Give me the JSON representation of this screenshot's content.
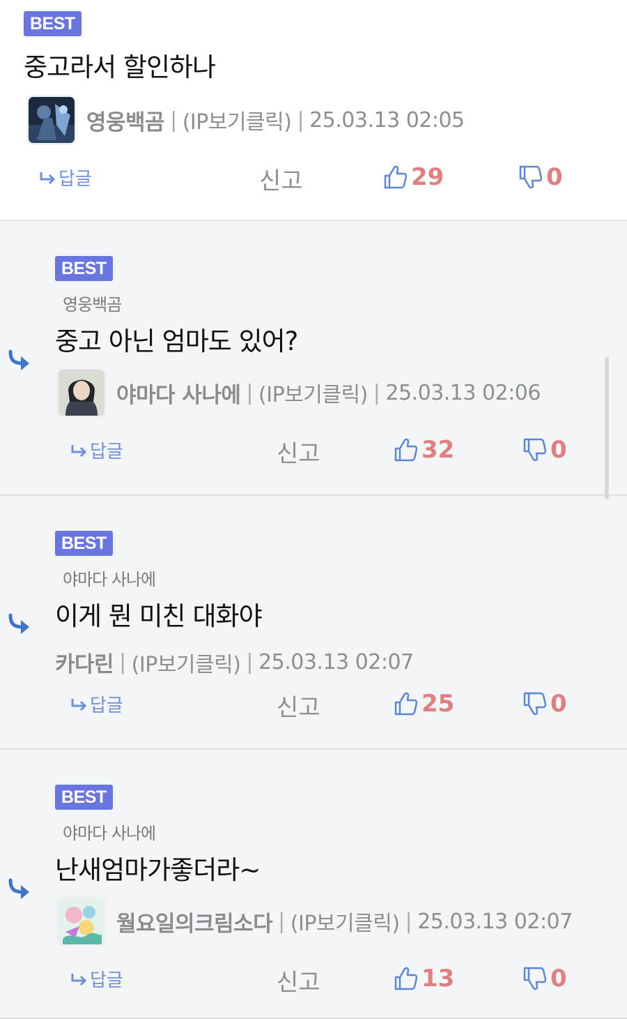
{
  "comments": [
    {
      "badge": "BEST",
      "mention": "",
      "text": "중고라서 할인하나",
      "author": "영웅백곰",
      "ip": "(IP보기클릭)",
      "timestamp": "25.03.13 02:05",
      "reply_label": "답글",
      "report_label": "신고",
      "likes": "29",
      "dislikes": "0"
    },
    {
      "badge": "BEST",
      "mention": "영웅백곰",
      "text": "중고 아닌 엄마도 있어?",
      "author": "야마다 사나에",
      "ip": "(IP보기클릭)",
      "timestamp": "25.03.13 02:06",
      "reply_label": "답글",
      "report_label": "신고",
      "likes": "32",
      "dislikes": "0"
    },
    {
      "badge": "BEST",
      "mention": "야마다 사나에",
      "text": "이게 뭔 미친 대화야",
      "author": "카다린",
      "ip": "(IP보기클릭)",
      "timestamp": "25.03.13 02:07",
      "reply_label": "답글",
      "report_label": "신고",
      "likes": "25",
      "dislikes": "0"
    },
    {
      "badge": "BEST",
      "mention": "야마다 사나에",
      "text": "난새엄마가좋더라~",
      "author": "월요일의크림소다",
      "ip": "(IP보기클릭)",
      "timestamp": "25.03.13 02:07",
      "reply_label": "답글",
      "report_label": "신고",
      "likes": "13",
      "dislikes": "0"
    }
  ],
  "icons": {
    "reply": "reply-arrow-icon",
    "thumbs_up": "thumbs-up-icon",
    "thumbs_down": "thumbs-down-icon",
    "nested_reply": "nested-reply-arrow-icon"
  },
  "colors": {
    "best_badge": "#6a76e0",
    "vote_count": "#e07f7f",
    "reply_accent": "#3f74c9",
    "reply_background": "#f4f5f7"
  }
}
